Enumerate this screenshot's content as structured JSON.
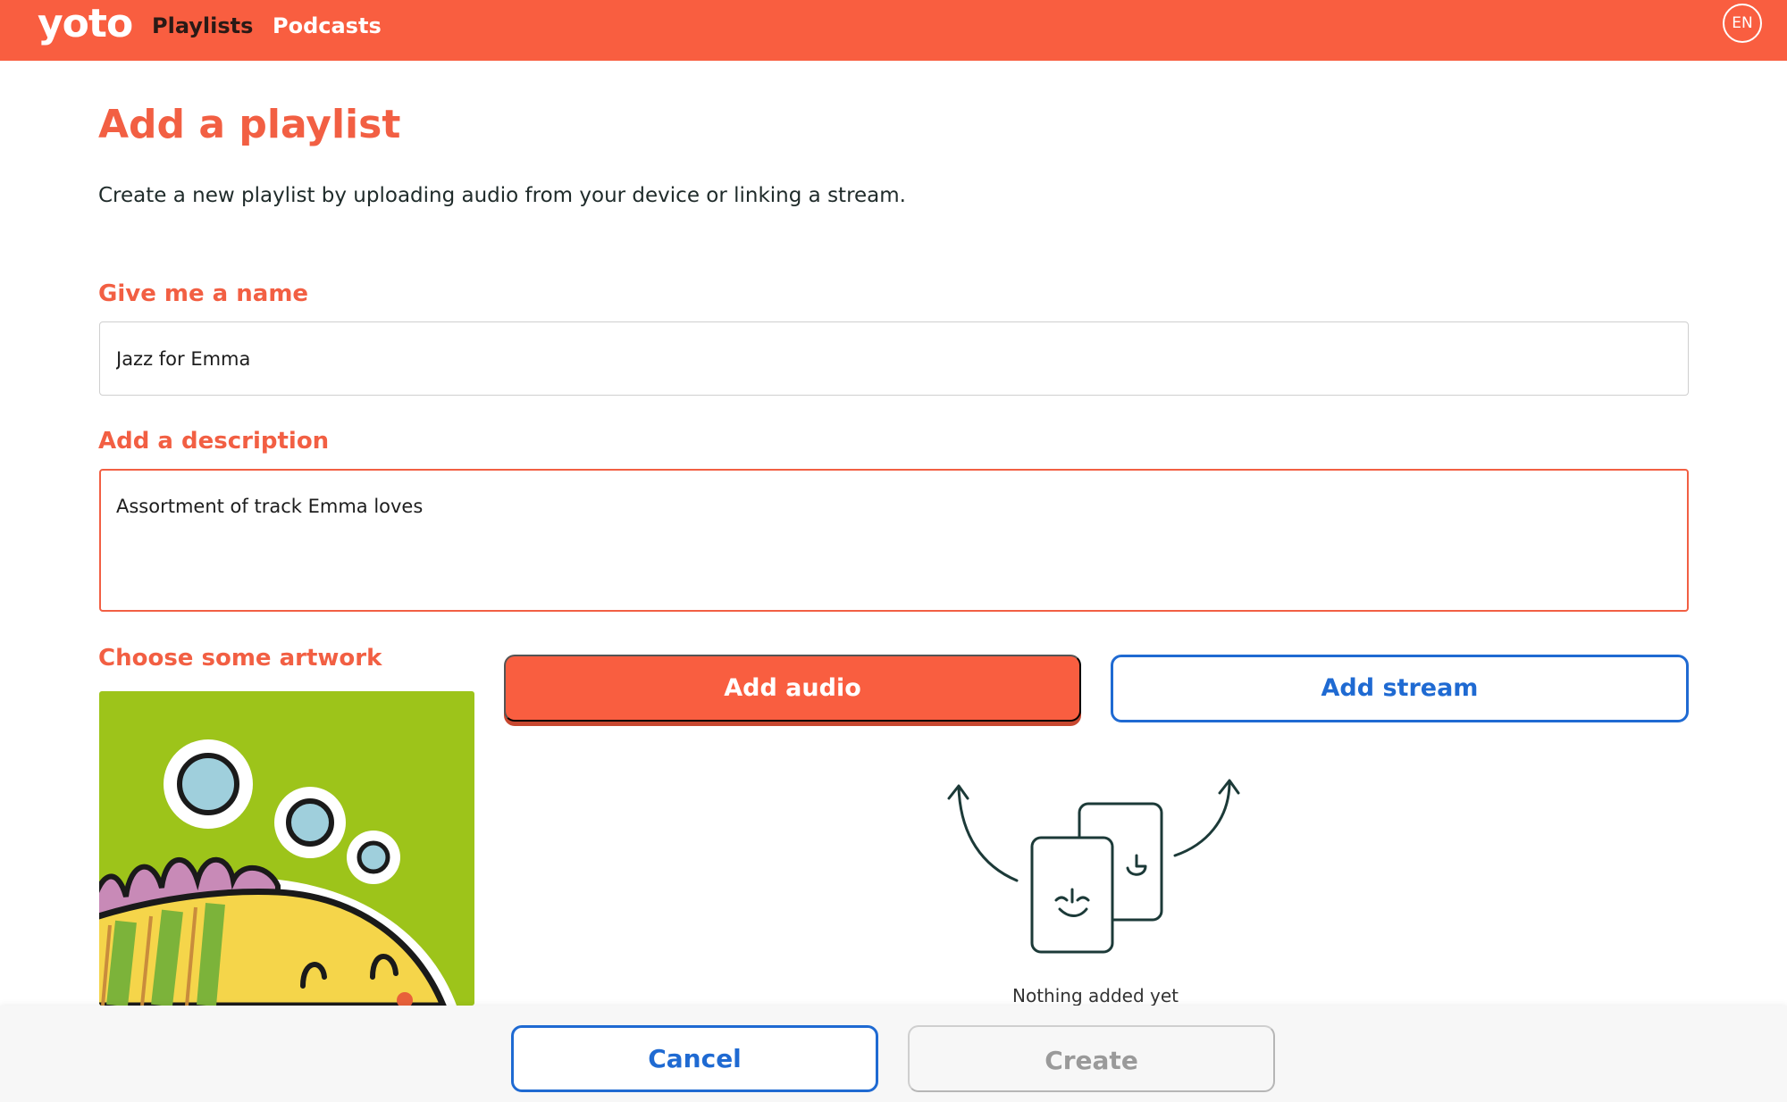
{
  "header": {
    "logo": "yoto",
    "nav": [
      {
        "label": "Playlists",
        "active": true
      },
      {
        "label": "Podcasts",
        "active": false
      }
    ],
    "language": "EN"
  },
  "page": {
    "title": "Add a playlist",
    "subtitle": "Create a new playlist by uploading audio from your device or linking a stream."
  },
  "form": {
    "name_label": "Give me a name",
    "name_value": "Jazz for Emma",
    "description_label": "Add a description",
    "description_value": "Assortment of track Emma loves",
    "artwork_label": "Choose some artwork"
  },
  "actions": {
    "add_audio": "Add audio",
    "add_stream": "Add stream"
  },
  "empty_state": {
    "text": "Nothing added yet",
    "icon": "cards-illustration"
  },
  "footer": {
    "cancel": "Cancel",
    "create": "Create"
  },
  "colors": {
    "brand": "#f95e40",
    "heading": "#f25f43",
    "link_blue": "#1f6ad2",
    "disabled": "#9a9a9a"
  }
}
